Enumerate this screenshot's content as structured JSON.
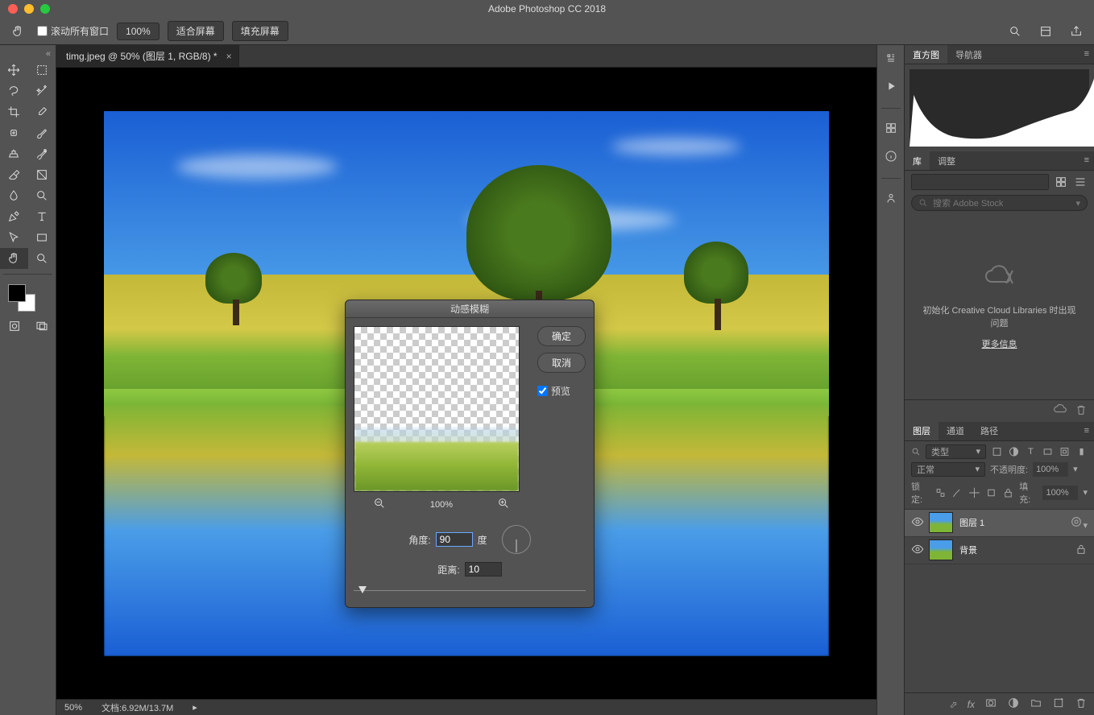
{
  "titlebar": {
    "app_title": "Adobe Photoshop CC 2018"
  },
  "optbar": {
    "scroll_all_windows": "滚动所有窗口",
    "zoom_value": "100%",
    "fit_screen": "适合屏幕",
    "fill_screen": "填充屏幕"
  },
  "document": {
    "tab_label": "timg.jpeg @ 50% (图层 1, RGB/8) *",
    "zoom": "50%",
    "doc_size": "文档:6.92M/13.7M"
  },
  "dialog": {
    "title": "动感模糊",
    "ok": "确定",
    "cancel": "取消",
    "preview_label": "预览",
    "zoom_pct": "100%",
    "angle_label": "角度:",
    "angle_value": "90",
    "angle_unit": "度",
    "distance_label": "距离:",
    "distance_value": "10"
  },
  "panels": {
    "histogram": {
      "tab1": "直方图",
      "tab2": "导航器"
    },
    "libraries": {
      "tab1": "库",
      "tab2": "调整",
      "search_placeholder": "搜索 Adobe Stock",
      "error_msg": "初始化 Creative Cloud Libraries 时出现问题",
      "more_info": "更多信息"
    },
    "layers": {
      "tab1": "图层",
      "tab2": "通道",
      "tab3": "路径",
      "filter_label": "类型",
      "blend_mode": "正常",
      "opacity_label": "不透明度:",
      "opacity_value": "100%",
      "lock_label": "锁定:",
      "fill_label": "填充:",
      "fill_value": "100%",
      "items": [
        {
          "name": "图层 1",
          "locked": false,
          "selected": true
        },
        {
          "name": "背景",
          "locked": true,
          "selected": false
        }
      ]
    }
  }
}
